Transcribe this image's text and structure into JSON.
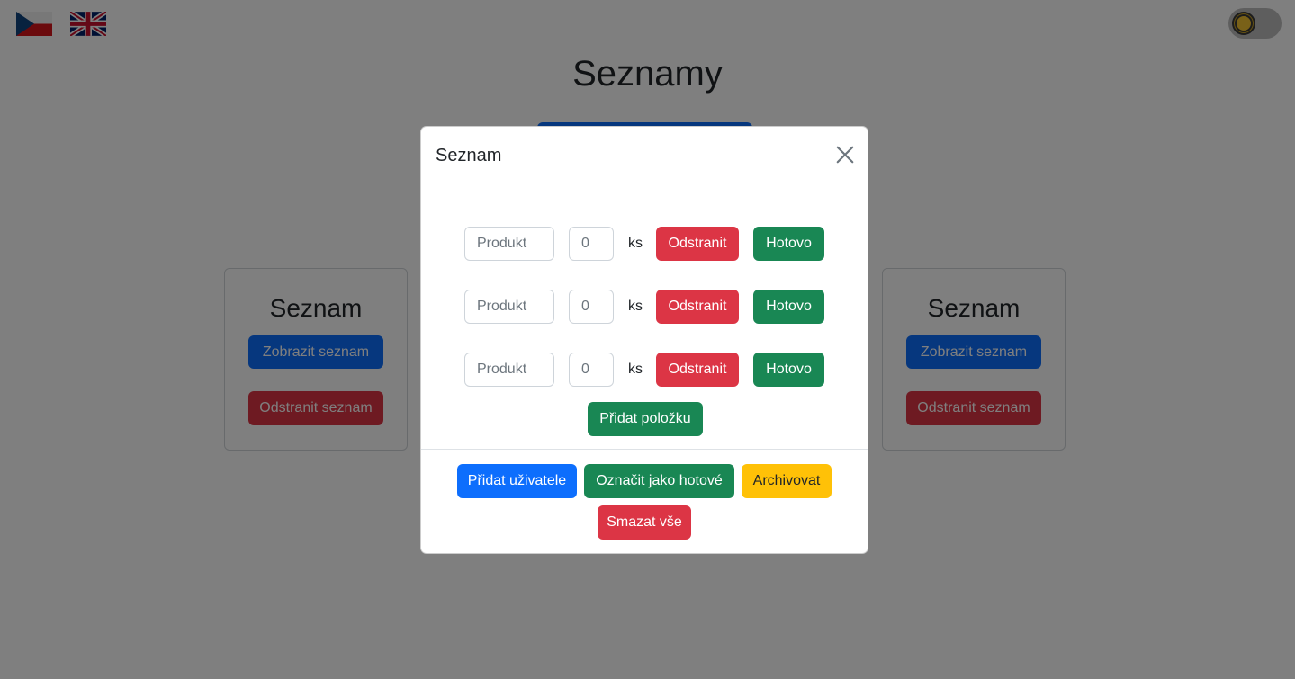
{
  "languages": {
    "cz": "Czech flag",
    "en": "UK flag"
  },
  "header": {
    "title": "Seznamy"
  },
  "cards": [
    {
      "title": "Seznam",
      "show_label": "Zobrazit seznam",
      "delete_label": "Odstranit seznam"
    },
    {
      "title": "Seznam",
      "show_label": "Zobrazit seznam",
      "delete_label": "Odstranit seznam"
    }
  ],
  "modal": {
    "title": "Seznam",
    "items": [
      {
        "product_placeholder": "Produkt",
        "quantity": "0",
        "unit": "ks",
        "remove_label": "Odstranit",
        "done_label": "Hotovo"
      },
      {
        "product_placeholder": "Produkt",
        "quantity": "0",
        "unit": "ks",
        "remove_label": "Odstranit",
        "done_label": "Hotovo"
      },
      {
        "product_placeholder": "Produkt",
        "quantity": "0",
        "unit": "ks",
        "remove_label": "Odstranit",
        "done_label": "Hotovo"
      }
    ],
    "add_item_label": "Přidat položku",
    "footer": {
      "add_user_label": "Přidat uživatele",
      "mark_done_label": "Označit jako hotové",
      "archive_label": "Archivovat",
      "delete_all_label": "Smazat vše"
    }
  },
  "colors": {
    "primary": "#0d6efd",
    "success": "#198754",
    "danger": "#dc3545",
    "warning": "#ffc107"
  }
}
